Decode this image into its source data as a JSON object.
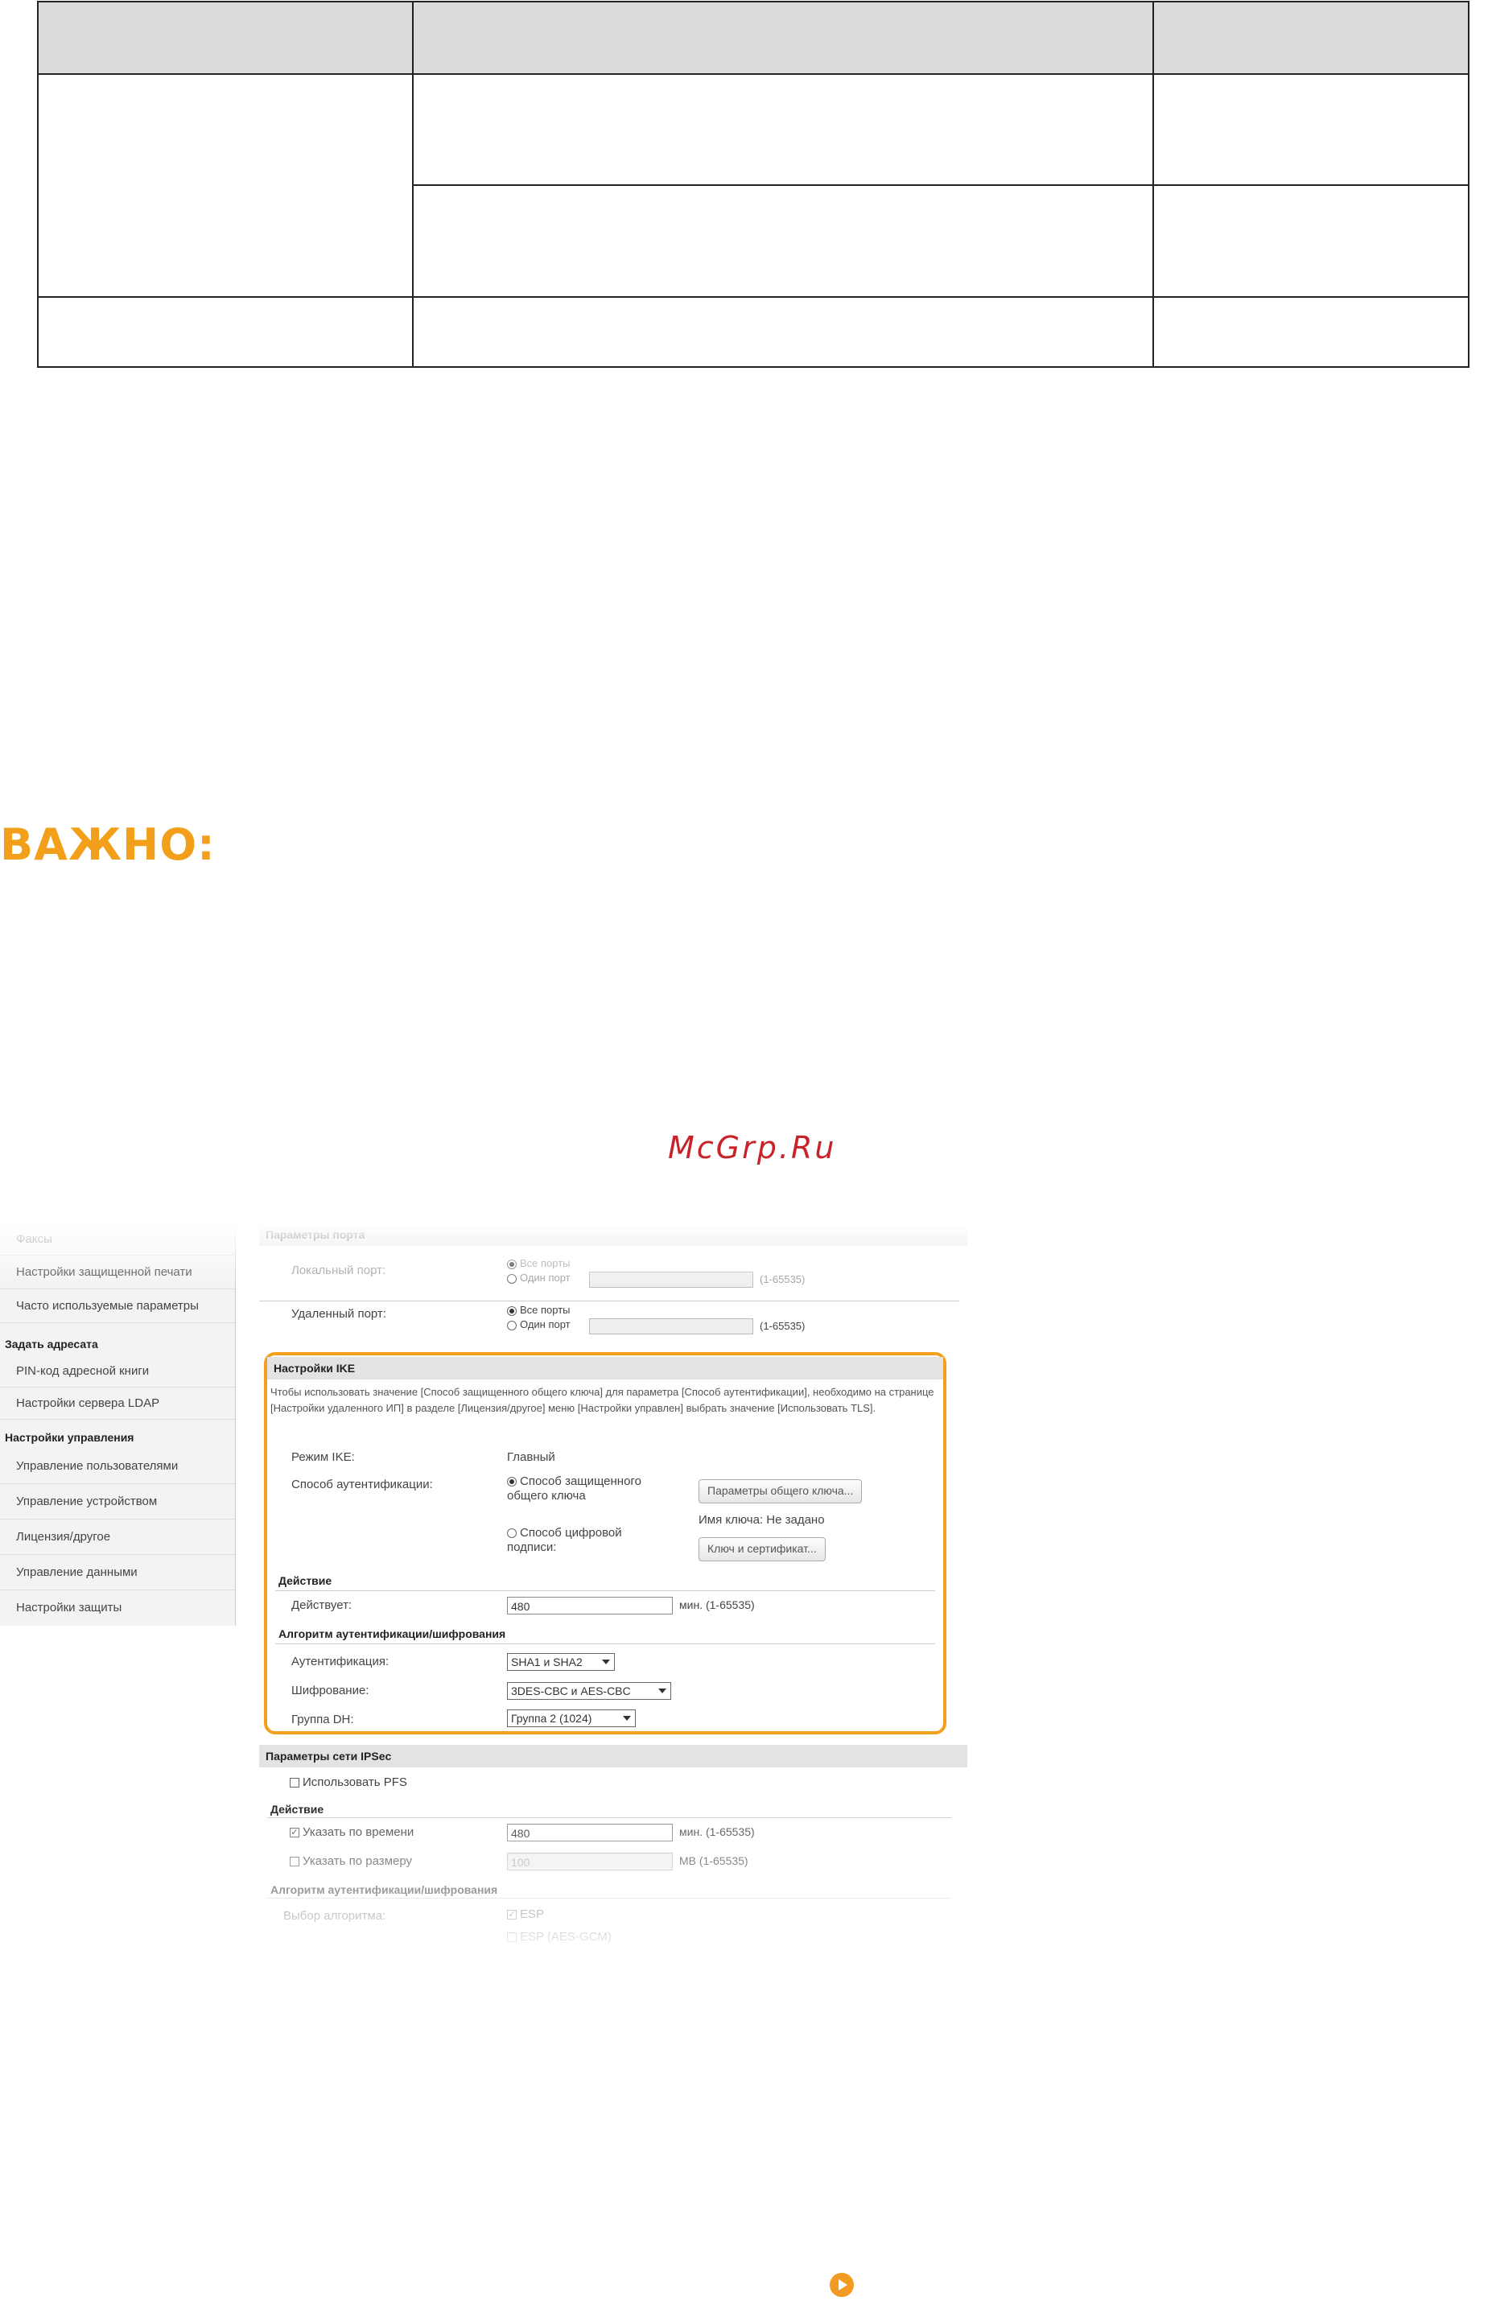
{
  "important_heading": "ВАЖНО:",
  "watermark": "McGrp.Ru",
  "sidebar": {
    "items": [
      {
        "label": "Факсы"
      },
      {
        "label": "Настройки защищенной печати"
      },
      {
        "label": "Часто используемые параметры"
      }
    ],
    "group_address": "Задать адресата",
    "address_items": [
      {
        "label": "PIN-код адресной книги"
      },
      {
        "label": "Настройки сервера LDAP"
      }
    ],
    "group_management": "Настройки управления",
    "management_items": [
      {
        "label": "Управление пользователями"
      },
      {
        "label": "Управление устройством"
      },
      {
        "label": "Лицензия/другое"
      },
      {
        "label": "Управление данными"
      },
      {
        "label": "Настройки защиты"
      }
    ]
  },
  "ports": {
    "section": "Параметры порта",
    "local_label": "Локальный порт:",
    "remote_label": "Удаленный порт:",
    "all_ports": "Все порты",
    "one_port": "Один порт",
    "range": "(1-65535)"
  },
  "ike": {
    "section": "Настройки IKE",
    "note": "Чтобы использовать значение [Способ защищенного общего ключа] для параметра [Способ аутентификации], необходимо на странице [Настройки удаленного ИП] в разделе [Лицензия/другое] меню [Настройки управлен] выбрать значение [Использовать TLS].",
    "mode_label": "Режим IKE:",
    "mode_value": "Главный",
    "auth_method_label": "Способ аутентификации:",
    "psk_option": "Способ защищенного общего ключа",
    "psk_button": "Параметры общего ключа...",
    "key_name": "Имя ключа: Не задано",
    "ds_option": "Способ цифровой подписи:",
    "ds_button": "Ключ и сертификат...",
    "validity_head": "Действие",
    "validity_label": "Действует:",
    "validity_value": "480",
    "validity_unit": "мин. (1-65535)",
    "algo_head": "Алгоритм аутентификации/шифрования",
    "auth_label": "Аутентификация:",
    "auth_value": "SHA1 и SHA2",
    "enc_label": "Шифрование:",
    "enc_value": "3DES-CBC и AES-CBC",
    "dh_label": "Группа DH:",
    "dh_value": "Группа 2 (1024)"
  },
  "ipsec": {
    "section": "Параметры сети IPSec",
    "pfs_label": "Использовать PFS",
    "validity_head": "Действие",
    "by_time_label": "Указать по времени",
    "by_time_value": "480",
    "by_time_unit": "мин. (1-65535)",
    "by_size_label": "Указать по размеру",
    "by_size_value": "100",
    "by_size_unit": "MB (1-65535)",
    "algo_head": "Алгоритм аутентификации/шифрования",
    "algo_select_label": "Выбор алгоритма:",
    "esp_label": "ESP",
    "esp_gcm_label": "ESP (AES-GCM)"
  },
  "colors": {
    "accent": "#f2a01c",
    "watermark": "#c8222a"
  }
}
